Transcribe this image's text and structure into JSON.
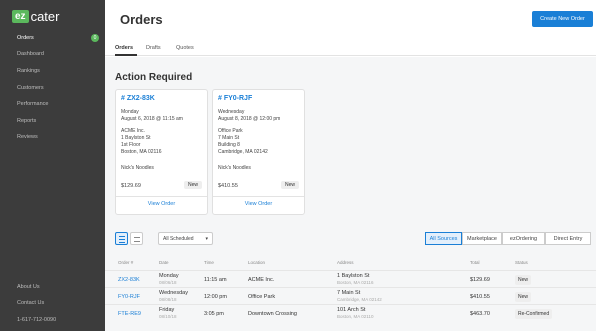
{
  "sidebar": {
    "logo_ez": "ez",
    "logo_cater": "cater",
    "items": [
      {
        "label": "Orders"
      },
      {
        "label": "Dashboard"
      },
      {
        "label": "Rankings"
      },
      {
        "label": "Customers"
      },
      {
        "label": "Performance"
      },
      {
        "label": "Reports"
      },
      {
        "label": "Reviews"
      }
    ],
    "orders_badge": "0",
    "footer": {
      "about": "About Us",
      "contact": "Contact Us",
      "phone": "1-617-712-0090"
    }
  },
  "header": {
    "title": "Orders",
    "create_label": "Create New Order"
  },
  "tabs": [
    "Orders",
    "Drafts",
    "Quotes"
  ],
  "action_required": {
    "title": "Action Required",
    "cards": [
      {
        "id": "# ZX2-83K",
        "day": "Monday",
        "datetime": "August 6, 2018 @ 11:15 am",
        "address": [
          "ACME Inc.",
          "1 Baylston St",
          "1st Floor",
          "Boston, MA 02116"
        ],
        "caterer": "Nick's Noodles",
        "price": "$129.69",
        "status": "New",
        "link": "View Order"
      },
      {
        "id": "# FY0-RJF",
        "day": "Wednesday",
        "datetime": "August 8, 2018 @ 12:00 pm",
        "address": [
          "Office Park",
          "7 Main St",
          "Building 8",
          "Cambridge, MA 02142"
        ],
        "caterer": "Nick's Noodles",
        "price": "$410.55",
        "status": "New",
        "link": "View Order"
      }
    ]
  },
  "toolbar": {
    "filter_value": "All Scheduled",
    "sources": [
      "All Sources",
      "Marketplace",
      "ezOrdering",
      "Direct Entry"
    ]
  },
  "table": {
    "headers": [
      "Order #",
      "Date",
      "Time",
      "Location",
      "Address",
      "Total",
      "Status"
    ],
    "rows": [
      {
        "order": "ZX2-83K",
        "day": "Monday",
        "date": "08/06/18",
        "time": "11:15 am",
        "location": "ACME Inc.",
        "address1": "1 Baylston St",
        "address2": "Boston, MA 02116",
        "total": "$129.69",
        "status": "New"
      },
      {
        "order": "FY0-RJF",
        "day": "Wednesday",
        "date": "08/08/18",
        "time": "12:00 pm",
        "location": "Office Park",
        "address1": "7 Main St",
        "address2": "Cambridge, MA 02142",
        "total": "$410.55",
        "status": "New"
      },
      {
        "order": "FTE-RE9",
        "day": "Friday",
        "date": "08/10/18",
        "time": "3:05 pm",
        "location": "Downtown Crossing",
        "address1": "101 Arch St",
        "address2": "Boston, MA 02110",
        "total": "$463.70",
        "status": "Re-Confirmed"
      }
    ]
  },
  "colors": {
    "accent": "#1a7fd6",
    "brand_green": "#5bb85d",
    "sidebar_bg": "#3c3c3c"
  }
}
